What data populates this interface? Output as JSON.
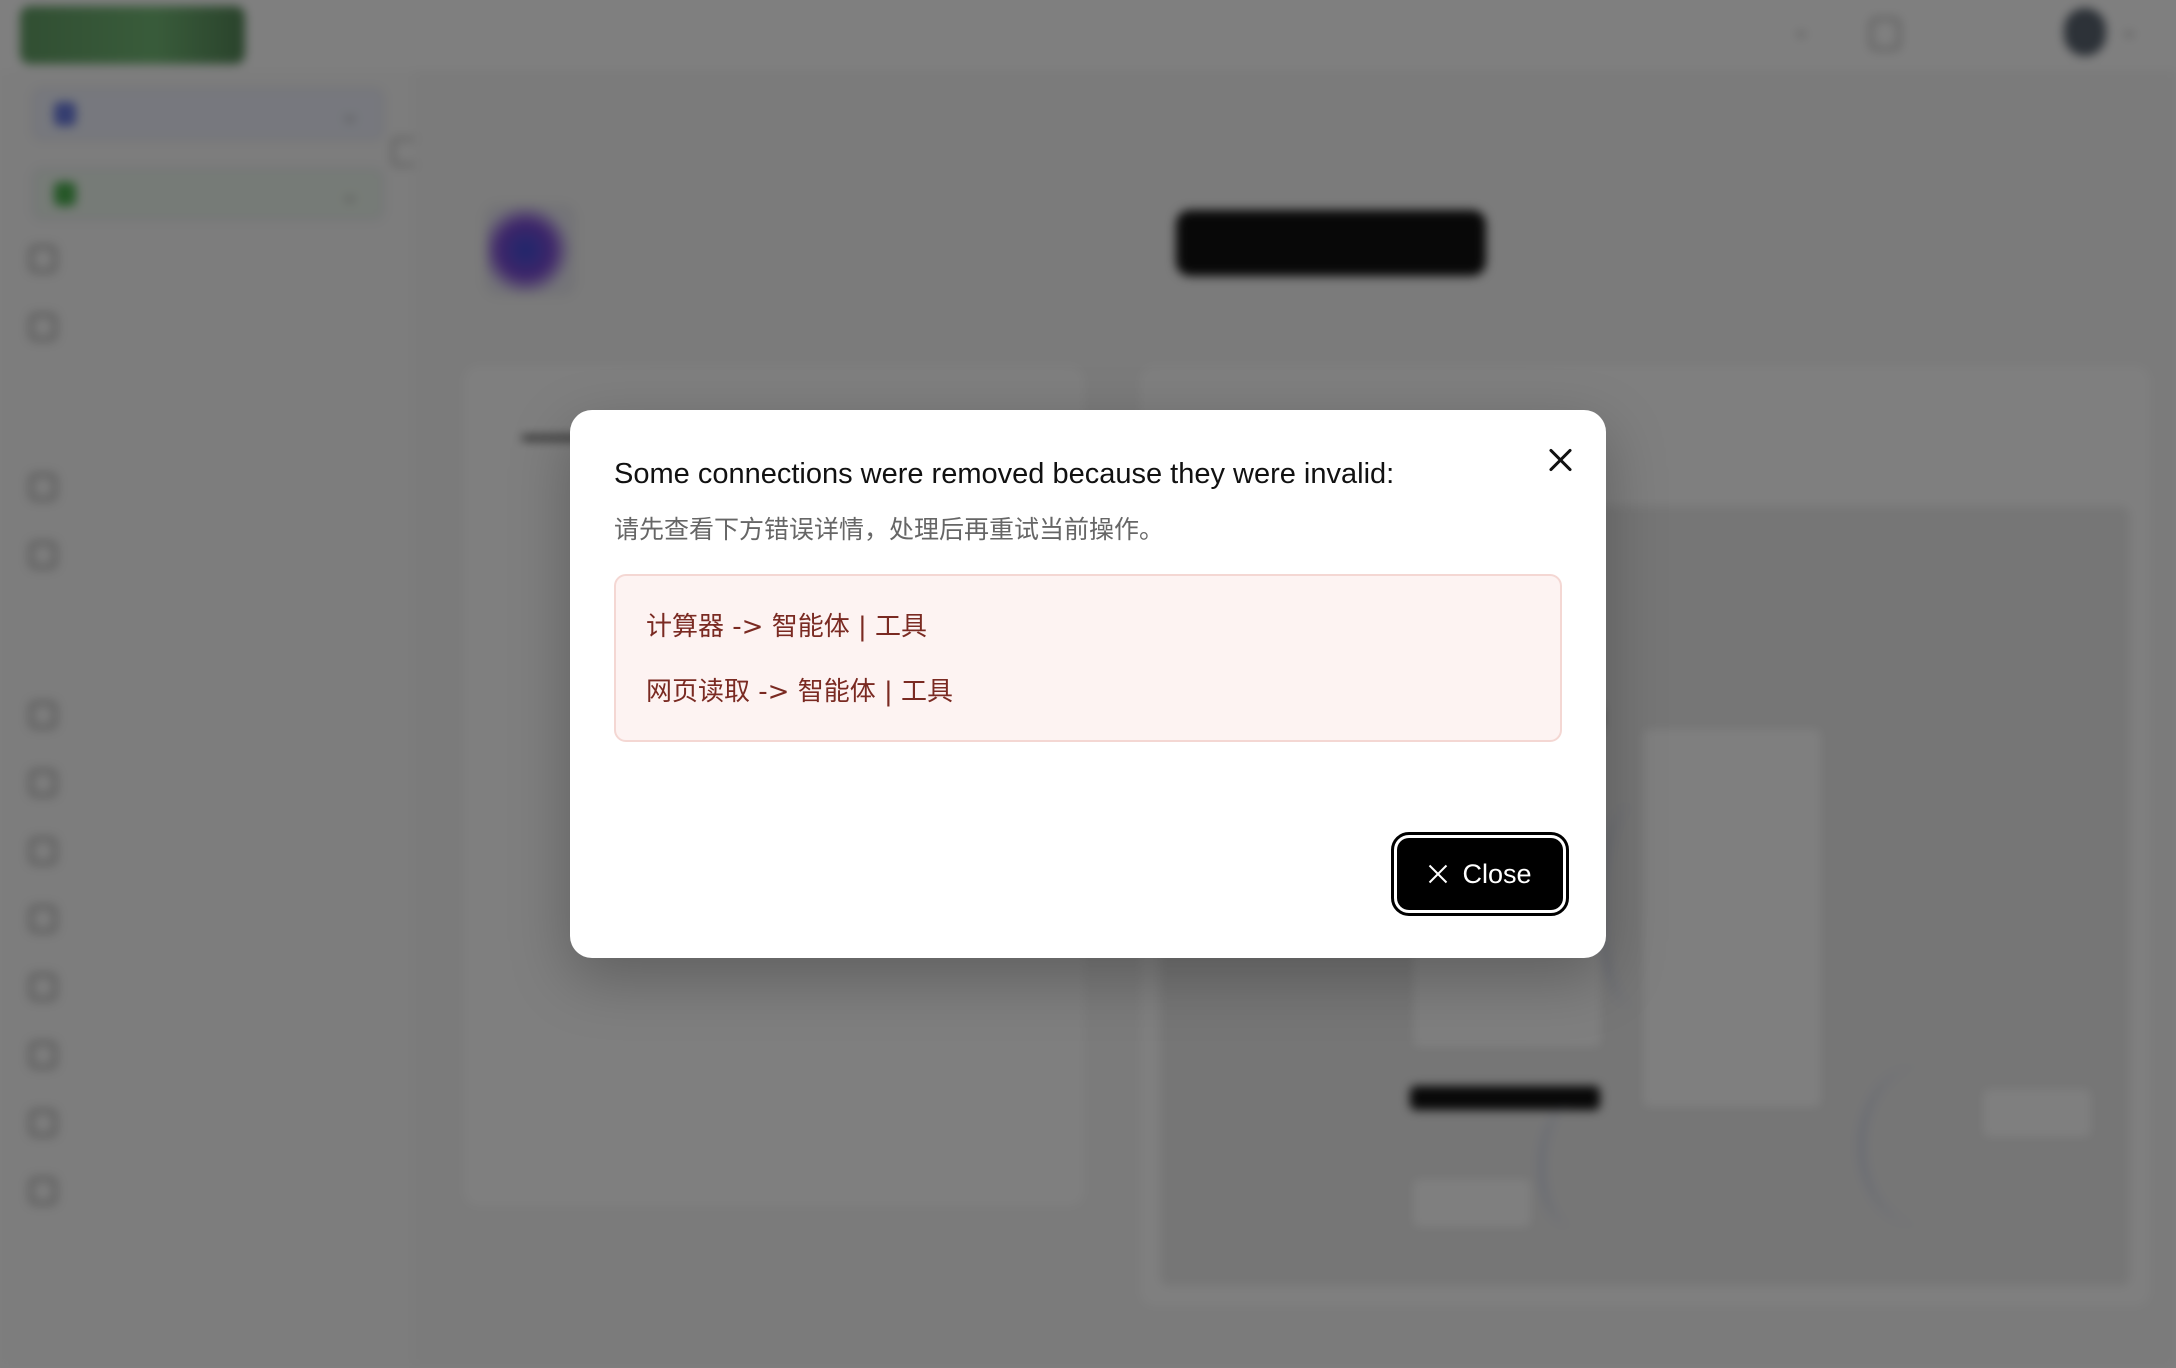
{
  "dialog": {
    "title": "Some connections were removed because they were invalid:",
    "subtitle": "请先查看下方错误详情，处理后再重试当前操作。",
    "errors": [
      "计算器 -> 智能体 | 工具",
      "网页读取 -> 智能体 | 工具"
    ],
    "close_label": "Close",
    "close_icon": "close-icon"
  },
  "colors": {
    "overlay": "#000000",
    "error_background": "#fdf3f2",
    "error_border": "#f4d7d3",
    "error_text": "#7a2a22",
    "primary_button": "#000000"
  }
}
